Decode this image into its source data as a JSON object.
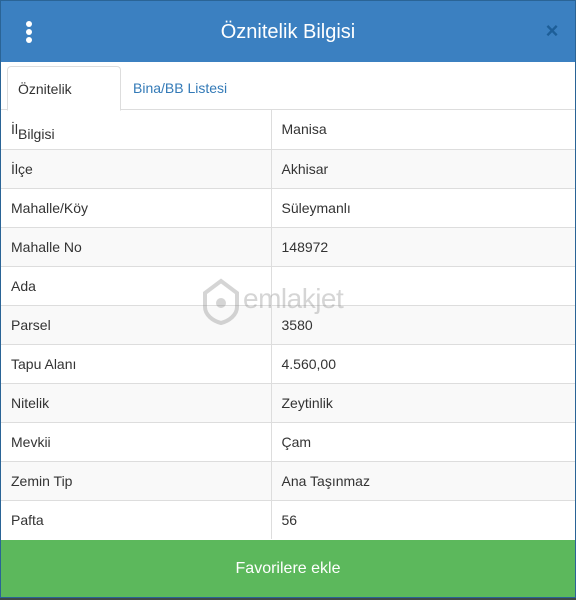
{
  "header": {
    "title": "Öznitelik Bilgisi",
    "close_label": "×"
  },
  "tabs": [
    {
      "label": "Öznitelik Bilgisi",
      "active": true
    },
    {
      "label": "Bina/BB Listesi",
      "active": false
    }
  ],
  "rows": [
    {
      "key": "İl",
      "value": "Manisa"
    },
    {
      "key": "İlçe",
      "value": "Akhisar"
    },
    {
      "key": "Mahalle/Köy",
      "value": "Süleymanlı"
    },
    {
      "key": "Mahalle No",
      "value": "148972"
    },
    {
      "key": "Ada",
      "value": ""
    },
    {
      "key": "Parsel",
      "value": "3580"
    },
    {
      "key": "Tapu Alanı",
      "value": "4.560,00"
    },
    {
      "key": "Nitelik",
      "value": "Zeytinlik"
    },
    {
      "key": "Mevkii",
      "value": "Çam"
    },
    {
      "key": "Zemin Tip",
      "value": "Ana Taşınmaz"
    },
    {
      "key": "Pafta",
      "value": "56"
    }
  ],
  "watermark": {
    "text": "emlakjet"
  },
  "footer": {
    "button_label": "Favorilere ekle"
  },
  "colors": {
    "header": "#3b80c1",
    "button": "#5cb85c",
    "link": "#337ab7"
  }
}
